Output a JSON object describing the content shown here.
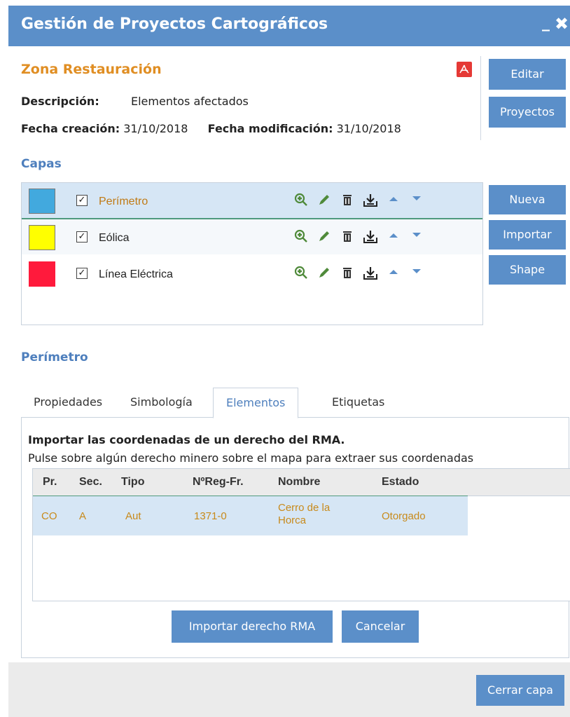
{
  "window": {
    "title": "Gestión de Proyectos Cartográficos",
    "minimize": "_",
    "close": "✖"
  },
  "project": {
    "name": "Zona Restauración",
    "pdf_icon": "pdf-icon",
    "description_label": "Descripción:",
    "description_value": "Elementos afectados",
    "created_label": "Fecha creación:",
    "created_value": "31/10/2018",
    "modified_label": "Fecha modificación:",
    "modified_value": "31/10/2018"
  },
  "project_buttons": {
    "edit": "Editar",
    "projects": "Proyectos"
  },
  "layers": {
    "title": "Capas",
    "items": [
      {
        "name": "Perímetro",
        "color": "#42a9de",
        "checked": "✓"
      },
      {
        "name": "Eólica",
        "color": "#ffff00",
        "checked": "✓"
      },
      {
        "name": "Línea Eléctrica",
        "color": "#ff1a3c",
        "checked": "✓"
      }
    ],
    "tools": [
      "zoom-in-icon",
      "pencil-icon",
      "trash-icon",
      "download-icon",
      "arrow-up-icon",
      "arrow-down-icon"
    ],
    "buttons": {
      "new": "Nueva",
      "import": "Importar",
      "shape": "Shape"
    }
  },
  "selected_layer": {
    "title": "Perímetro",
    "tabs": [
      "Propiedades",
      "Simbología",
      "Elementos",
      "Etiquetas"
    ],
    "active_tab": "Elementos"
  },
  "import_panel": {
    "heading": "Importar las coordenadas de un derecho del RMA.",
    "instruction": "Pulse sobre algún derecho minero sobre el mapa para extraer sus coordenadas",
    "columns": [
      "Pr.",
      "Sec.",
      "Tipo",
      "NºReg-Fr.",
      "Nombre",
      "Estado"
    ],
    "rows": [
      {
        "pr": "CO",
        "sec": "A",
        "tipo": "Aut",
        "reg": "1371-0",
        "nombre": "Cerro de la Horca",
        "estado": "Otorgado"
      }
    ],
    "import_button": "Importar derecho RMA",
    "cancel_button": "Cancelar"
  },
  "footer": {
    "close_layer": "Cerrar capa"
  },
  "colors": {
    "accent": "#5b8fc9",
    "highlight": "#e08e23",
    "section": "#4e7fbd"
  }
}
